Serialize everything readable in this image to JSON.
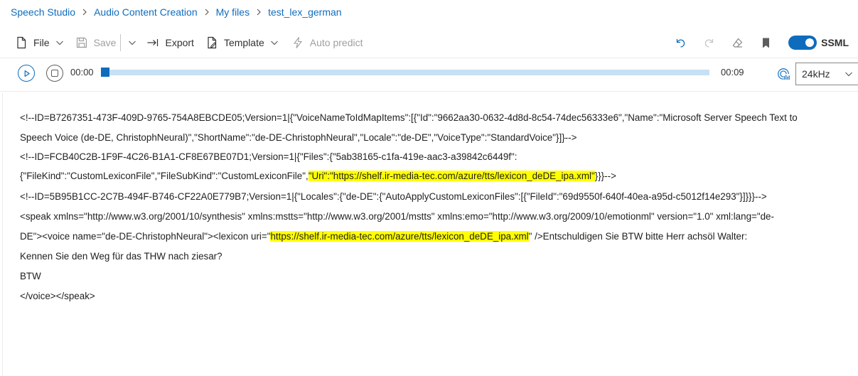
{
  "breadcrumb": [
    "Speech Studio",
    "Audio Content Creation",
    "My files",
    "test_lex_german"
  ],
  "toolbar": {
    "file": "File",
    "save": "Save",
    "export": "Export",
    "template": "Template",
    "auto_predict": "Auto predict",
    "ssml_label": "SSML",
    "ssml_enabled": true
  },
  "player": {
    "current_time": "00:00",
    "duration": "00:09",
    "progress": 0,
    "sample_rate": "24kHz"
  },
  "colors": {
    "accent": "#0f6cbd",
    "track": "#c7e0f4",
    "highlight": "#ffff00"
  },
  "editor": {
    "line1": "<!--ID=B7267351-473F-409D-9765-754A8EBCDE05;Version=1|{\"VoiceNameToIdMapItems\":[{\"Id\":\"9662aa30-0632-4d8d-8c54-74dec56333e6\",\"Name\":\"Microsoft Server Speech Text to",
    "line2": "Speech Voice (de-DE, ChristophNeural)\",\"ShortName\":\"de-DE-ChristophNeural\",\"Locale\":\"de-DE\",\"VoiceType\":\"StandardVoice\"}]}-->",
    "line3": "<!--ID=FCB40C2B-1F9F-4C26-B1A1-CF8E67BE07D1;Version=1|{\"Files\":{\"5ab38165-c1fa-419e-aac3-a39842c6449f\":",
    "line4_pre": "{\"FileKind\":\"CustomLexiconFile\",\"FileSubKind\":\"CustomLexiconFile\",",
    "line4_hl": "\"Uri\":\"https://shelf.ir-media-tec.com/azure/tts/lexicon_deDE_ipa.xml\"",
    "line4_post": "}}}-->",
    "line5": "<!--ID=5B95B1CC-2C7B-494F-B746-CF22A0E779B7;Version=1|{\"Locales\":{\"de-DE\":{\"AutoApplyCustomLexiconFiles\":[{\"FileId\":\"69d9550f-640f-40ea-a95d-c5012f14e293\"}]}}}-->",
    "line6": "<speak xmlns=\"http://www.w3.org/2001/10/synthesis\" xmlns:mstts=\"http://www.w3.org/2001/mstts\" xmlns:emo=\"http://www.w3.org/2009/10/emotionml\" version=\"1.0\" xml:lang=\"de-",
    "line7_pre": "DE\"><voice name=\"de-DE-ChristophNeural\"><lexicon uri=\"",
    "line7_hl": "https://shelf.ir-media-tec.com/azure/tts/lexicon_deDE_ipa.xml",
    "line7_post": "\" />Entschuldigen Sie BTW bitte Herr achsöl Walter:",
    "line8": "Kennen Sie den Weg für das THW nach ziesar?",
    "line9": "BTW",
    "line10": "</voice></speak>"
  }
}
